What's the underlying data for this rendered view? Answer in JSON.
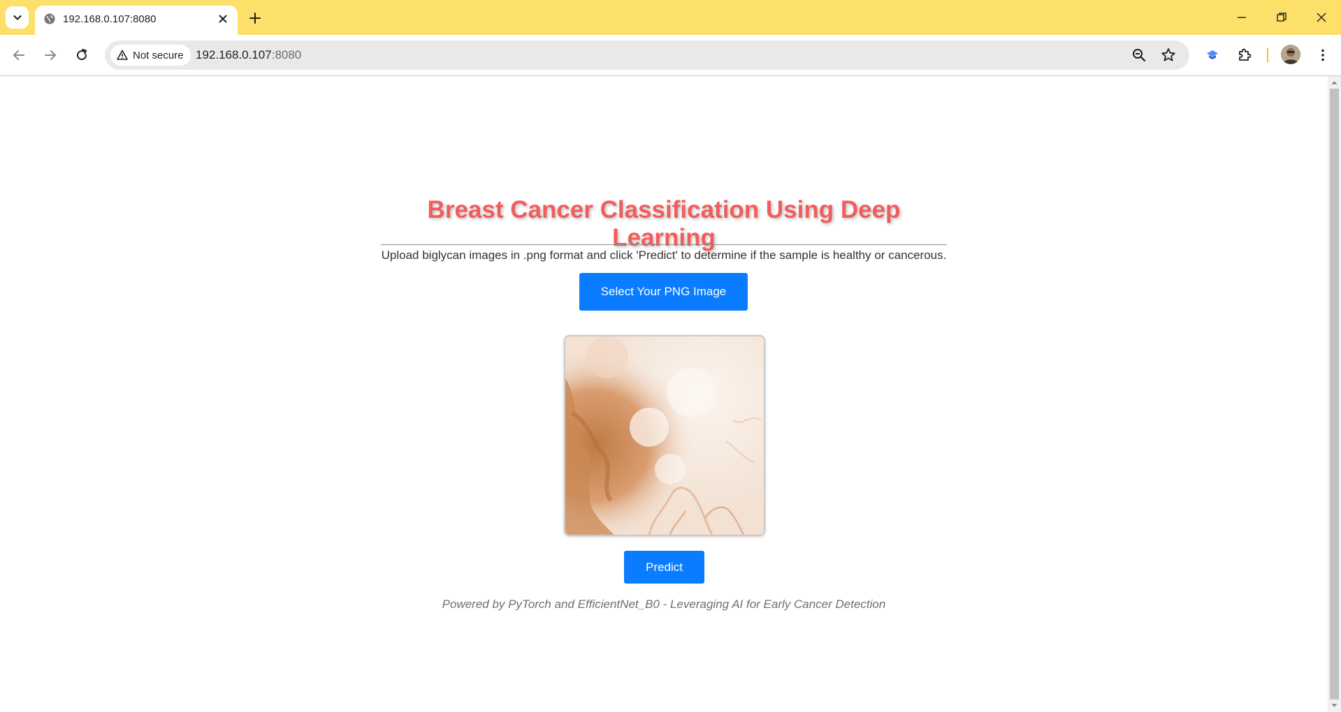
{
  "browser": {
    "tab": {
      "title": "192.168.0.107:8080"
    },
    "address_bar": {
      "security_label": "Not secure",
      "url_host": "192.168.0.107",
      "url_port": ":8080"
    },
    "icons": {
      "tab_search": "chevron-down-icon",
      "favicon": "globe-icon",
      "tab_close": "close-icon",
      "new_tab": "plus-icon",
      "back": "arrow-left-icon",
      "forward": "arrow-right-icon",
      "reload": "reload-icon",
      "zoom": "zoom-out-icon",
      "bookmark": "star-icon",
      "extension": "puzzle-icon",
      "menu": "kebab-icon"
    },
    "colors": {
      "tabstrip": "#fde06a",
      "accent_button": "#0a7cff",
      "heading": "#f25c5c"
    }
  },
  "page": {
    "heading": "Breast Cancer Classification Using Deep Learning",
    "description": "Upload biglycan images in .png format and click 'Predict' to determine if the sample is healthy or cancerous.",
    "select_button_label": "Select Your PNG Image",
    "preview_alt": "Uploaded biglycan image preview",
    "predict_button_label": "Predict",
    "footer": "Powered by PyTorch and EfficientNet_B0 - Leveraging AI for Early Cancer Detection"
  }
}
